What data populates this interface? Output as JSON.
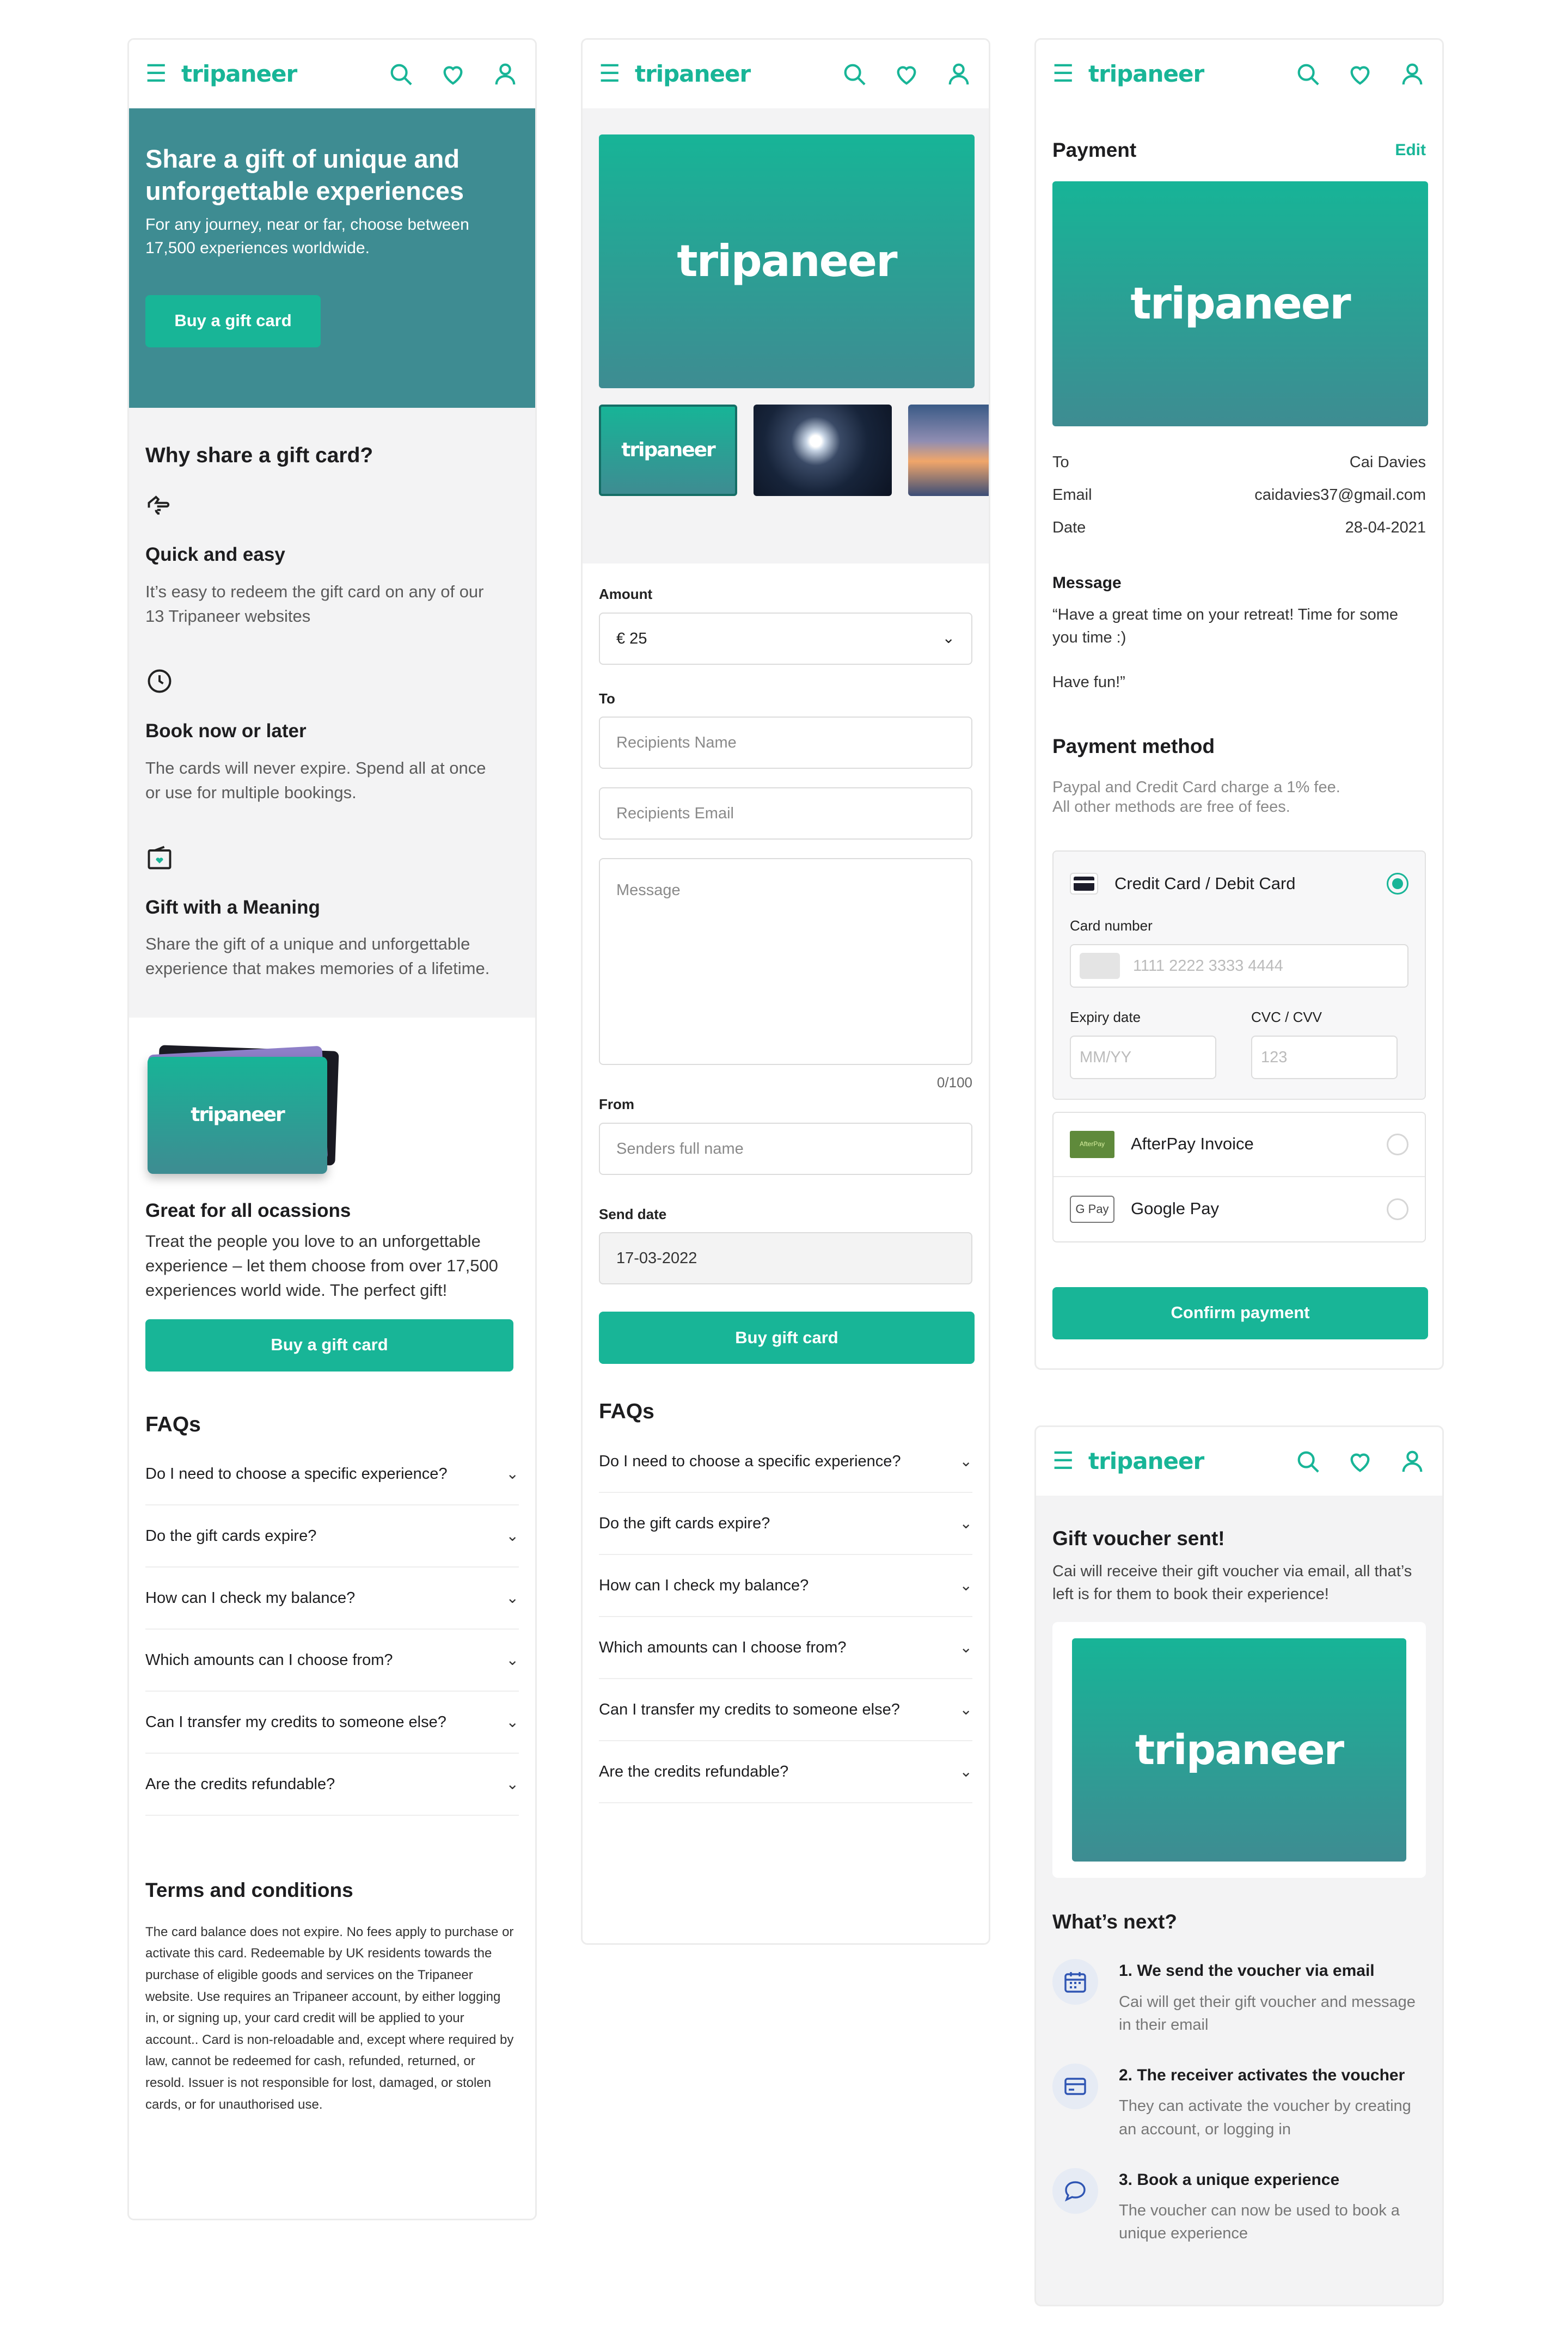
{
  "brand": {
    "name": "tripaneer",
    "accent": "#18b597",
    "hero_bg": "#3e8c92"
  },
  "nav_icons": [
    "menu-icon",
    "search-icon",
    "heart-icon",
    "user-icon"
  ],
  "screen1": {
    "hero": {
      "title": "Share a gift of unique and unforgettable experiences",
      "subtitle": "For any journey, near or far, choose between 17,500 experiences worldwide.",
      "cta": "Buy a gift card"
    },
    "why": {
      "title": "Why share a gift card?",
      "items": [
        {
          "icon": "hand-icon",
          "title": "Quick and easy",
          "text": "It’s easy to redeem the gift card on any of our 13 Tripaneer websites"
        },
        {
          "icon": "clock-icon",
          "title": "Book now or later",
          "text": "The cards will never expire. Spend all at once or use for multiple bookings."
        },
        {
          "icon": "gift-box-icon",
          "title": "Gift with a Meaning",
          "text": "Share the gift of a unique and unforgettable experience that makes memories of a lifetime."
        }
      ]
    },
    "occasions": {
      "title": "Great for all ocassions",
      "text": "Treat the people you love to an unforgettable experience – let them choose from over 17,500 experiences world wide. The perfect gift!",
      "cta": "Buy a gift card"
    },
    "faqs_title": "FAQs",
    "terms": {
      "title": "Terms and conditions",
      "text": "The card balance does not expire. No fees apply to purchase or activate this card. Redeemable by UK residents towards the purchase of eligible goods and services on the Tripaneer website. Use requires an Tripaneer account, by either logging in, or signing up, your card credit will be applied to your account.. Card is non-reloadable and, except where required by law, cannot be redeemed for cash, refunded, returned, or resold. Issuer is not responsible for lost, damaged, or stolen cards, or for unauthorised use."
    }
  },
  "faqs": [
    "Do I need to choose a specific experience?",
    "Do the gift cards expire?",
    "How can I check my balance?",
    "Which amounts can I choose from?",
    "Can I transfer my credits to someone else?",
    "Are the credits refundable?"
  ],
  "screen2": {
    "amount_label": "Amount",
    "amount_value": "€ 25",
    "to_label": "To",
    "recipient_name_placeholder": "Recipients Name",
    "recipient_email_placeholder": "Recipients Email",
    "message_placeholder": "Message",
    "message_counter": "0/100",
    "from_label": "From",
    "sender_placeholder": "Senders full name",
    "send_date_label": "Send date",
    "send_date_value": "17-03-2022",
    "cta": "Buy gift card",
    "faqs_title": "FAQs"
  },
  "screen3": {
    "title": "Payment",
    "edit": "Edit",
    "details": [
      {
        "label": "To",
        "value": "Cai Davies"
      },
      {
        "label": "Email",
        "value": "caidavies37@gmail.com"
      },
      {
        "label": "Date",
        "value": "28-04-2021"
      }
    ],
    "message_label": "Message",
    "message_text": "“Have a great time on your retreat! Time for some you time :)",
    "message_sign": "Have fun!”",
    "method_title": "Payment method",
    "method_note_1": "Paypal and Credit Card charge a 1% fee.",
    "method_note_2": "All other methods are free of fees.",
    "card_option": "Credit Card / Debit Card",
    "card_number_label": "Card number",
    "card_number_placeholder": "1111 2222 3333 4444",
    "expiry_label": "Expiry date",
    "expiry_placeholder": "MM/YY",
    "cvc_label": "CVC / CVV",
    "cvc_placeholder": "123",
    "afterpay": "AfterPay Invoice",
    "afterpay_logo": "AfterPay",
    "googlepay": "Google Pay",
    "googlepay_logo": "G Pay",
    "cta": "Confirm payment"
  },
  "screen4": {
    "title": "Gift voucher sent!",
    "text": "Cai will receive their gift voucher via email, all that’s left is for them to book their experience!",
    "next_title": "What’s next?",
    "steps": [
      {
        "icon": "calendar-icon",
        "title": "1. We send the voucher via email",
        "text": "Cai will get their gift voucher and message in their email"
      },
      {
        "icon": "card-icon",
        "title": "2. The receiver activates the voucher",
        "text": "They can activate the voucher by creating an account, or logging in"
      },
      {
        "icon": "chat-icon",
        "title": "3. Book a unique experience",
        "text": "The voucher can now be used to book a unique experience"
      }
    ]
  }
}
